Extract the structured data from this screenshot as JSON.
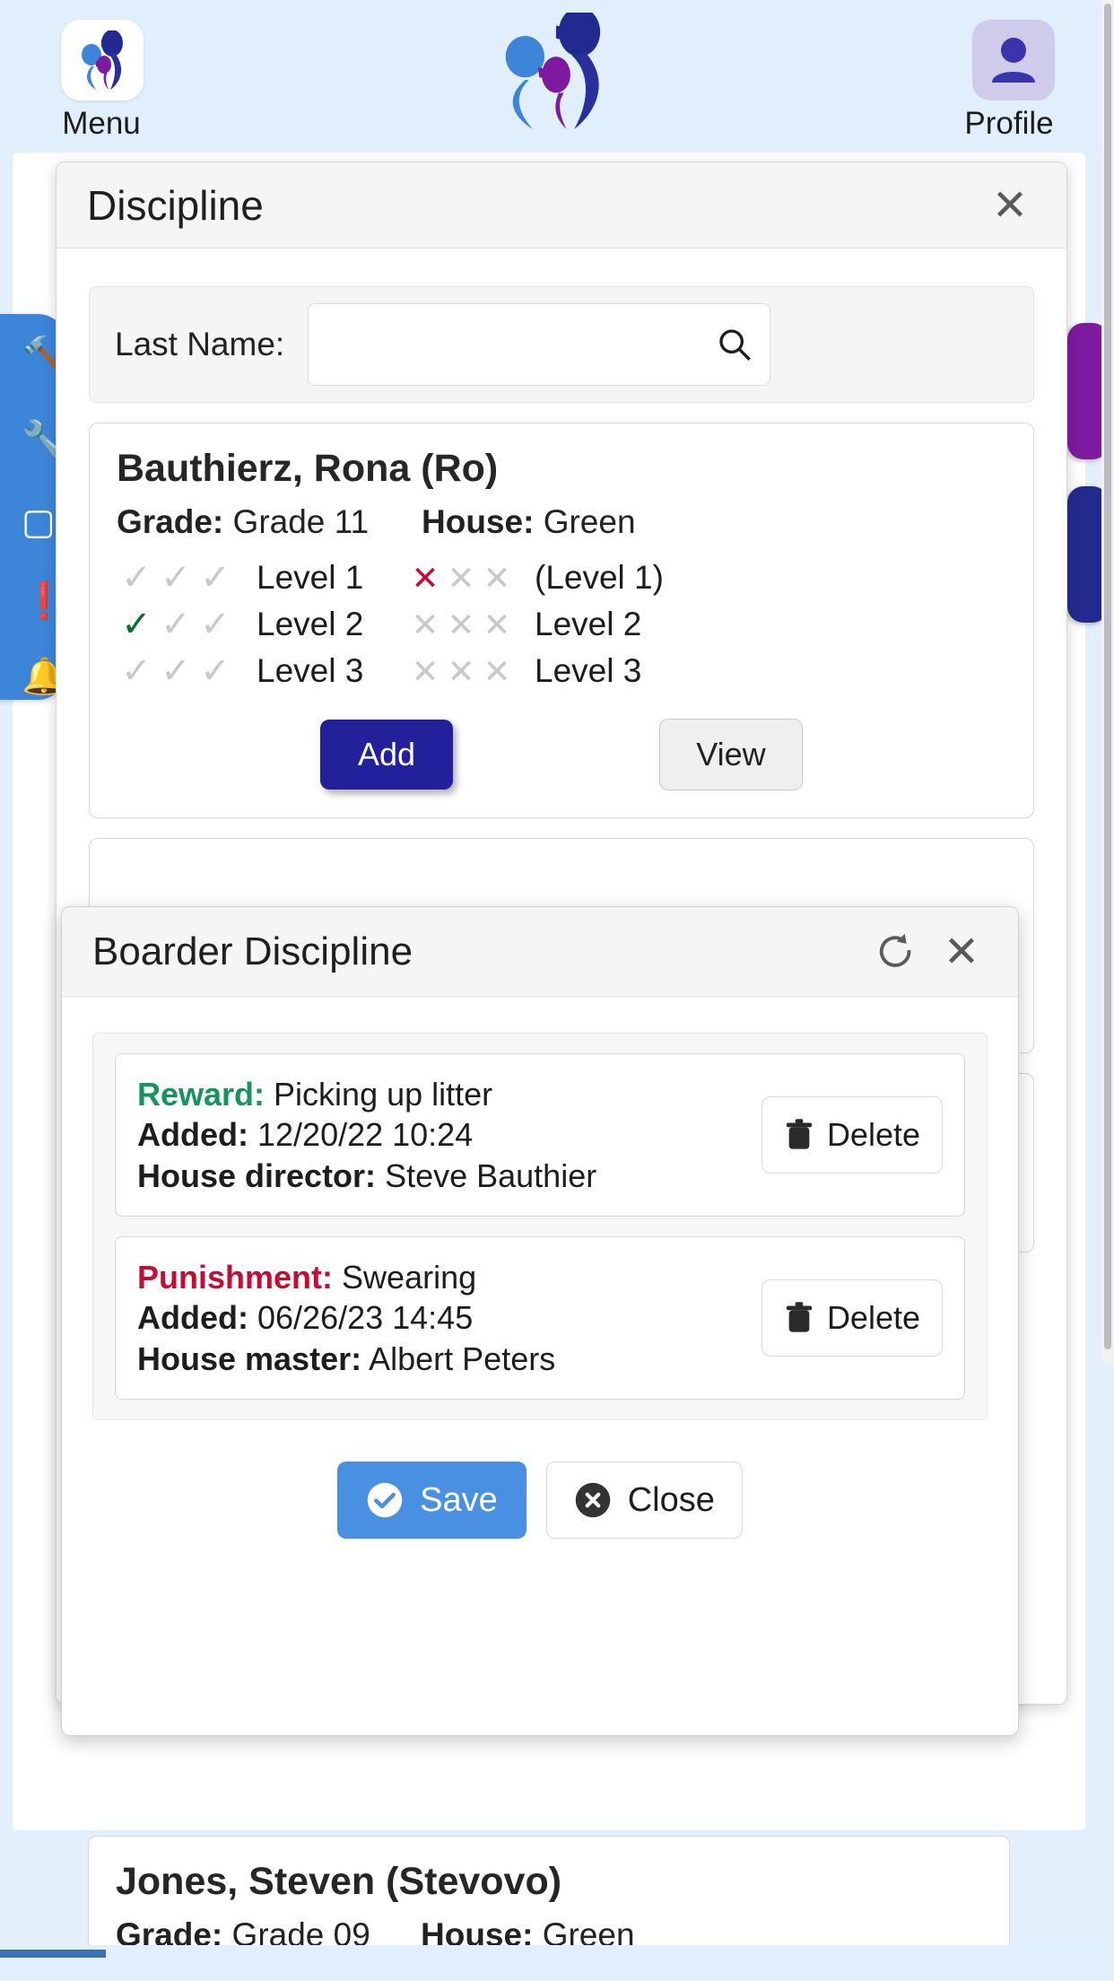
{
  "appbar": {
    "menu_label": "Menu",
    "profile_label": "Profile",
    "menu_icon": "app-logo-icon",
    "profile_icon": "user-avatar-icon"
  },
  "sidebar": {
    "icons": [
      "tools-icon",
      "brush-icon",
      "document-icon",
      "exclamation-icon",
      "bell-icon"
    ],
    "color": "#3d85d8"
  },
  "right_tabs": [
    {
      "name": "purple-tab",
      "color": "#7d1aa0"
    },
    {
      "name": "navy-tab",
      "color": "#222a8f"
    }
  ],
  "discipline_modal": {
    "title": "Discipline",
    "close_icon": "close-icon",
    "search": {
      "label": "Last Name:",
      "value": "",
      "placeholder": "",
      "icon": "search-icon"
    },
    "student": {
      "name": "Bauthierz, Rona (Ro)",
      "grade_label": "Grade:",
      "grade_value": "Grade 11",
      "house_label": "House:",
      "house_value": "Green",
      "levels": [
        {
          "checks": [
            "off",
            "off",
            "off"
          ],
          "left_label": "Level 1",
          "crosses": [
            "on",
            "off",
            "off"
          ],
          "right_label": "(Level 1)"
        },
        {
          "checks": [
            "on",
            "off",
            "off"
          ],
          "left_label": "Level 2",
          "crosses": [
            "off",
            "off",
            "off"
          ],
          "right_label": "Level 2"
        },
        {
          "checks": [
            "off",
            "off",
            "off"
          ],
          "left_label": "Level 3",
          "crosses": [
            "off",
            "off",
            "off"
          ],
          "right_label": "Level 3"
        }
      ],
      "add_label": "Add",
      "view_label": "View"
    }
  },
  "boarder_modal": {
    "title": "Boarder Discipline",
    "refresh_icon": "refresh-icon",
    "close_icon": "close-icon",
    "entries": [
      {
        "type_label": "Reward:",
        "type_kind": "reward",
        "type_value": "Picking up litter",
        "added_label": "Added:",
        "added_value": "12/20/22 10:24",
        "staff_label": "House director:",
        "staff_value": "Steve Bauthier",
        "delete_label": "Delete",
        "delete_icon": "trash-icon"
      },
      {
        "type_label": "Punishment:",
        "type_kind": "punishment",
        "type_value": "Swearing",
        "added_label": "Added:",
        "added_value": "06/26/23 14:45",
        "staff_label": "House master:",
        "staff_value": "Albert Peters",
        "delete_label": "Delete",
        "delete_icon": "trash-icon"
      }
    ],
    "save_label": "Save",
    "save_icon": "check-circle-icon",
    "close_label": "Close",
    "close_btn_icon": "x-circle-icon"
  },
  "bottom_student": {
    "name": "Jones, Steven (Stevovo)",
    "grade_label": "Grade:",
    "grade_value": "Grade 09",
    "house_label": "House:",
    "house_value": "Green"
  },
  "colors": {
    "accent_blue": "#4a90e2",
    "primary_navy": "#23209b",
    "reward_green": "#16945e",
    "punish_red": "#c20e35",
    "page_bg": "#e1effc"
  }
}
